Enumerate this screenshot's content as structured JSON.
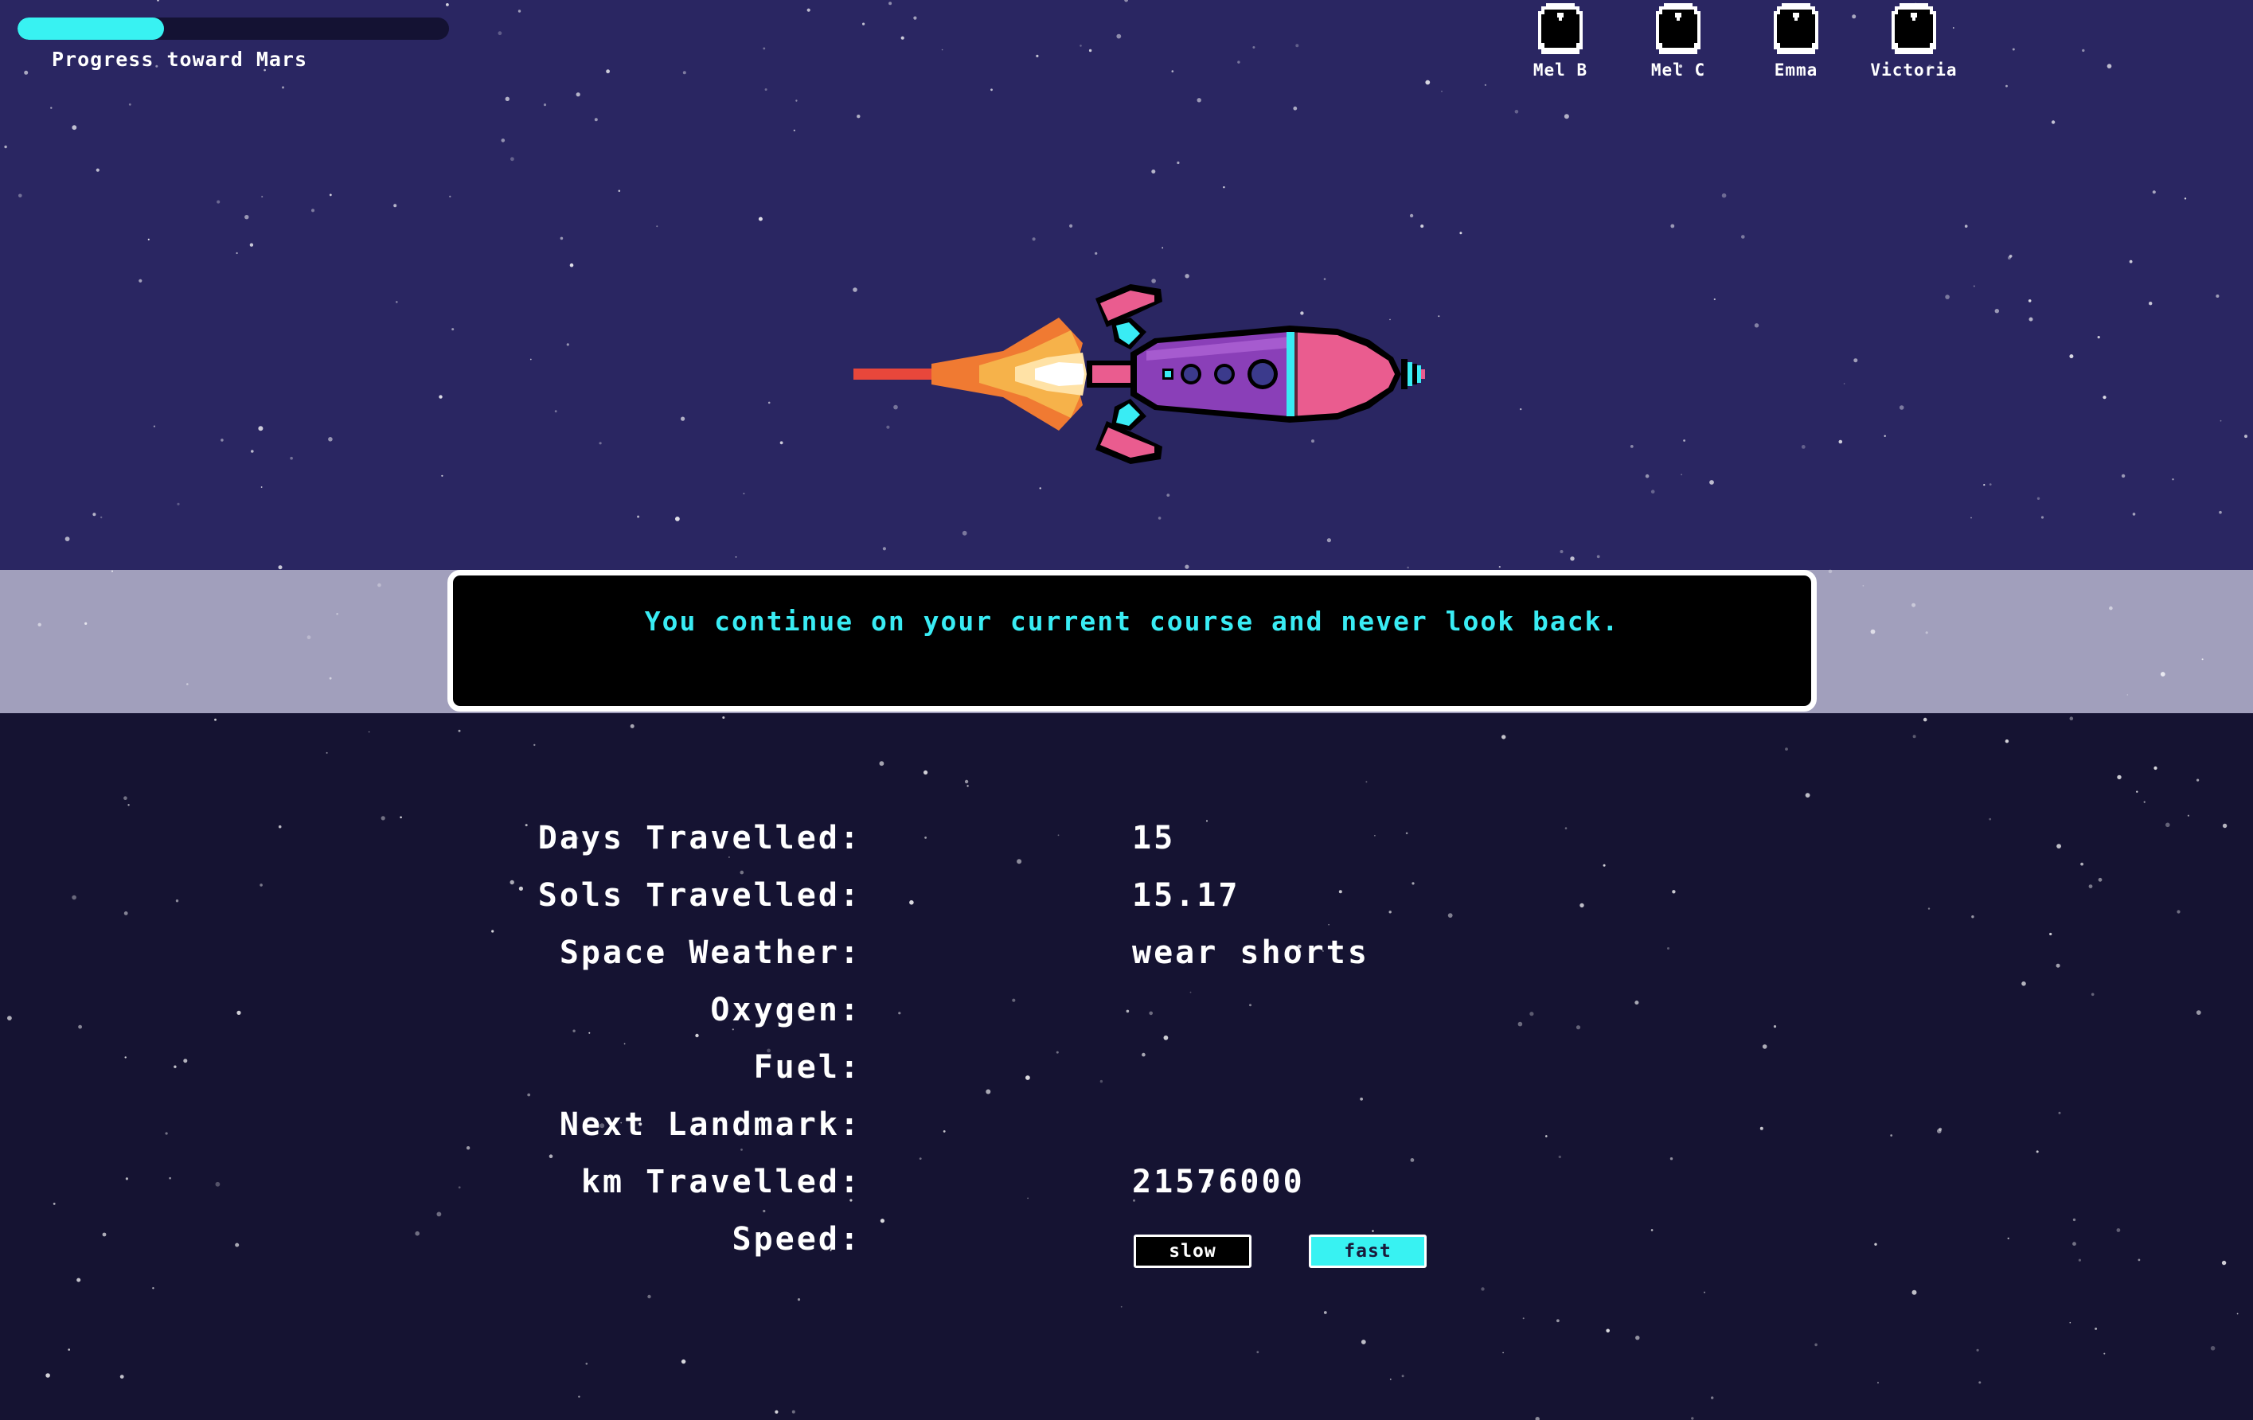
{
  "progress": {
    "label": "Progress toward Mars",
    "fraction": 0.34,
    "color": "#38f2f2"
  },
  "crew": [
    {
      "name": "Mel B",
      "icon": "astronaut-helmet-icon"
    },
    {
      "name": "Mel C",
      "icon": "astronaut-helmet-icon"
    },
    {
      "name": "Emma",
      "icon": "astronaut-helmet-icon"
    },
    {
      "name": "Victoria",
      "icon": "astronaut-helmet-icon"
    }
  ],
  "rocket": {
    "icon": "pixel-rocket-icon"
  },
  "message": {
    "text": "You continue on your current course and never look back.",
    "color": "#39ecf4"
  },
  "stats": {
    "days": {
      "label": "Days Travelled:",
      "value": "15"
    },
    "sols": {
      "label": "Sols Travelled:",
      "value": "15.17"
    },
    "weather": {
      "label": "Space Weather:",
      "value": "wear shorts"
    },
    "oxygen": {
      "label": "Oxygen:",
      "value": ""
    },
    "fuel": {
      "label": "Fuel:",
      "value": ""
    },
    "landmark": {
      "label": "Next Landmark:",
      "value": ""
    },
    "km": {
      "label": "km Travelled:",
      "value": "21576000"
    },
    "speed": {
      "label": "Speed:",
      "slow_label": "slow",
      "fast_label": "fast",
      "selected": "fast"
    }
  },
  "colors": {
    "sky_top": "#2a2662",
    "band": "#a19fbc",
    "sky_bottom": "#151332",
    "accent": "#38f2f2",
    "rocket_body": "#8a3fb8",
    "rocket_nose": "#ea5c8f"
  }
}
